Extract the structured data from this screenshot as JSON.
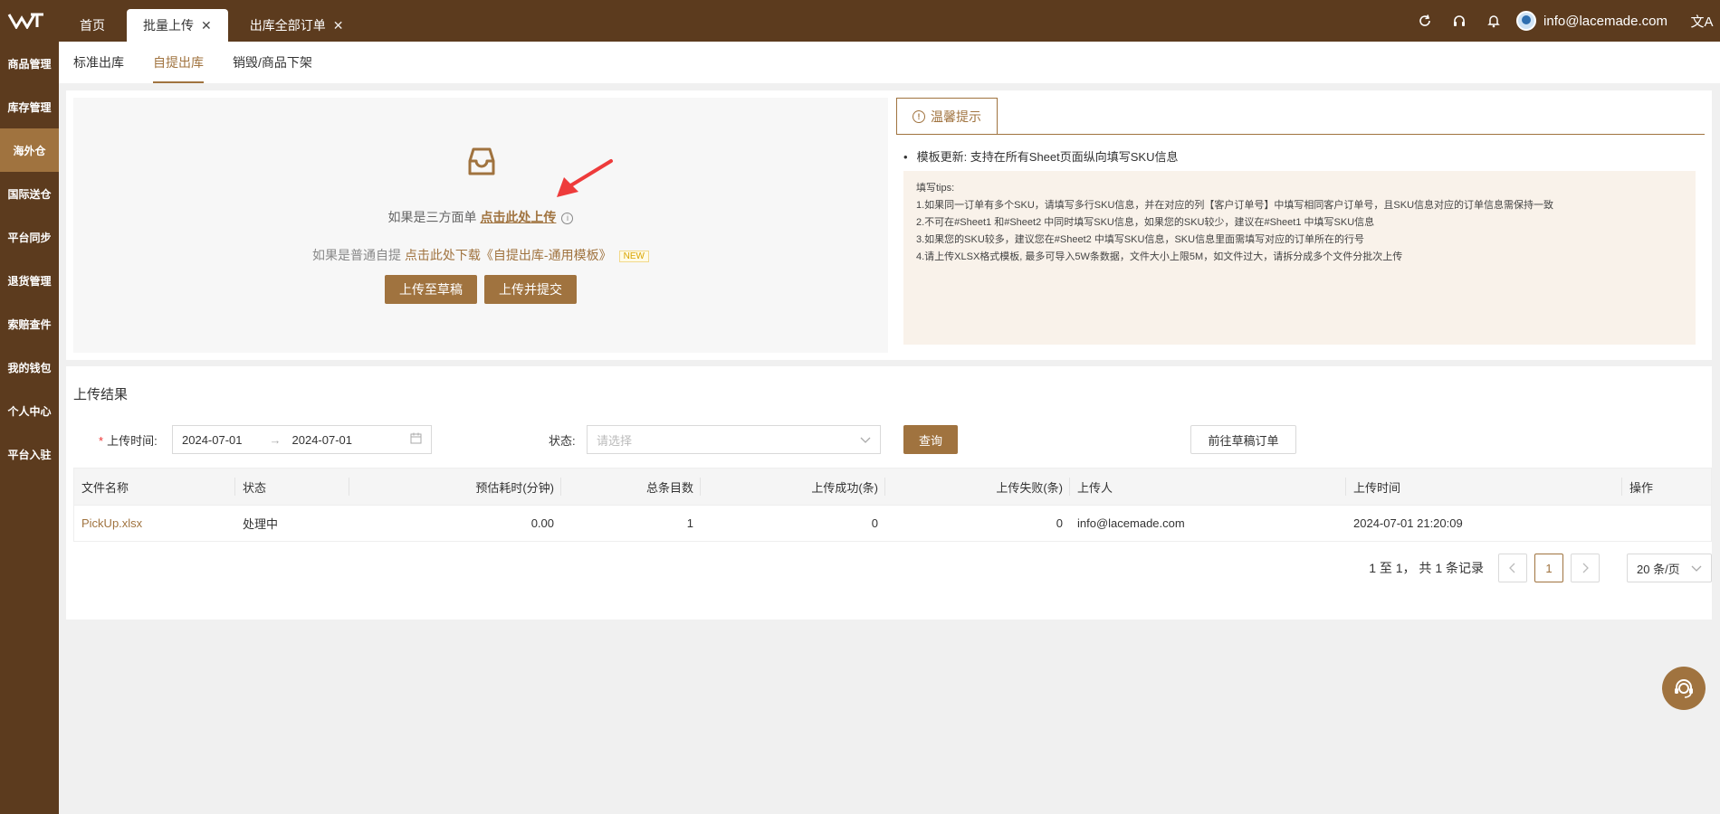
{
  "topbar": {
    "tabs": [
      {
        "label": "首页",
        "closable": false,
        "active": false
      },
      {
        "label": "批量上传",
        "closable": true,
        "active": true
      },
      {
        "label": "出库全部订单",
        "closable": true,
        "active": false
      }
    ],
    "close_glyph": "✕",
    "user_email": "info@lacemade.com",
    "icons": [
      "refresh-icon",
      "headset-icon",
      "bell-icon",
      "translate-icon"
    ],
    "lang_glyph": "文A"
  },
  "sidebar": {
    "items": [
      {
        "label": "商品管理",
        "active": false
      },
      {
        "label": "库存管理",
        "active": false
      },
      {
        "label": "海外仓",
        "active": true
      },
      {
        "label": "国际送仓",
        "active": false
      },
      {
        "label": "平台同步",
        "active": false
      },
      {
        "label": "退货管理",
        "active": false
      },
      {
        "label": "索赔查件",
        "active": false
      },
      {
        "label": "我的钱包",
        "active": false
      },
      {
        "label": "个人中心",
        "active": false
      },
      {
        "label": "平台入驻",
        "active": false
      }
    ]
  },
  "subtabs": [
    {
      "label": "标准出库",
      "active": false
    },
    {
      "label": "自提出库",
      "active": true
    },
    {
      "label": "销毁/商品下架",
      "active": false
    }
  ],
  "upload": {
    "line1_prefix": "如果是三方面单 ",
    "line1_link": "点击此处上传",
    "line2_prefix": "如果是普通自提 ",
    "line2_link": "点击此处下载《自提出库-通用模板》",
    "new_badge": "NEW",
    "btn_draft": "上传至草稿",
    "btn_submit": "上传并提交"
  },
  "tips": {
    "tab_label": "温馨提示",
    "bullet": "模板更新: 支持在所有Sheet页面纵向填写SKU信息",
    "heading": "填写tips:",
    "lines": [
      "1.如果同一订单有多个SKU，请填写多行SKU信息，并在对应的列【客户订单号】中填写相同客户订单号，且SKU信息对应的订单信息需保持一致",
      "2.不可在#Sheet1 和#Sheet2 中同时填写SKU信息，如果您的SKU较少，建议在#Sheet1 中填写SKU信息",
      "3.如果您的SKU较多，建议您在#Sheet2 中填写SKU信息，SKU信息里面需填写对应的订单所在的行号",
      "4.请上传XLSX格式模板, 最多可导入5W条数据，文件大小上限5M，如文件过大，请拆分成多个文件分批次上传"
    ]
  },
  "results": {
    "title": "上传结果",
    "filter": {
      "time_label": "上传时间:",
      "required_mark": "*",
      "date_start": "2024-07-01",
      "date_end": "2024-07-01",
      "status_label": "状态:",
      "status_placeholder": "请选择",
      "query_btn": "查询",
      "draft_btn": "前往草稿订单"
    },
    "columns": [
      "文件名称",
      "状态",
      "预估耗时(分钟)",
      "总条目数",
      "上传成功(条)",
      "上传失败(条)",
      "上传人",
      "上传时间",
      "操作"
    ],
    "rows": [
      {
        "file": "PickUp.xlsx",
        "status": "处理中",
        "eta": "0.00",
        "total": "1",
        "success": "0",
        "failed": "0",
        "uploader": "info@lacemade.com",
        "time": "2024-07-01 21:20:09",
        "action": ""
      }
    ],
    "pager": {
      "summary": "1 至 1， 共 1 条记录",
      "current_page": "1",
      "page_size": "20 条/页"
    }
  },
  "colors": {
    "brand_dark": "#5c3b1e",
    "accent": "#a0733f",
    "arrow_red": "#ee3b3b"
  }
}
